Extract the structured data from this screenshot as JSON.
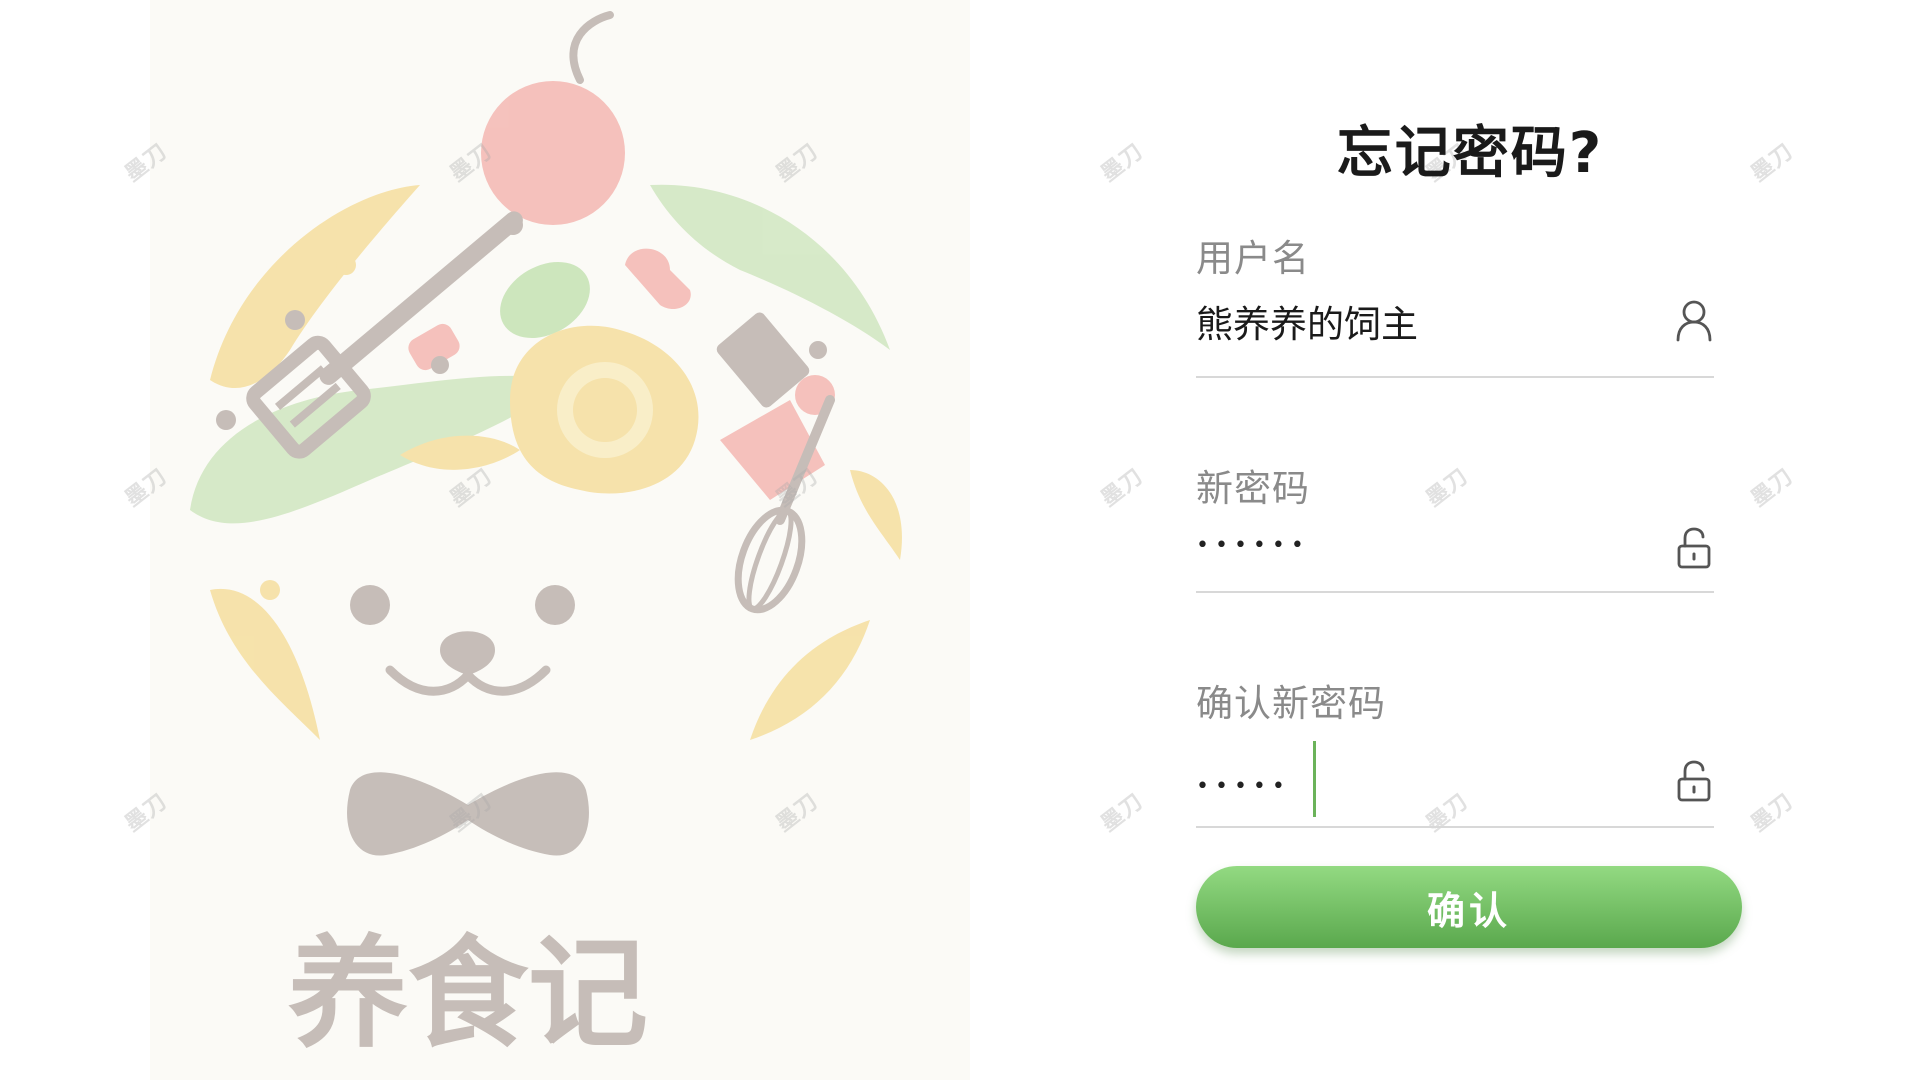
{
  "logo": {
    "brand_text": "养食记"
  },
  "watermark_text": "墨刀",
  "form": {
    "title": "忘记密码?",
    "username": {
      "label": "用户名",
      "value": "熊养养的饲主",
      "icon": "user-icon"
    },
    "new_password": {
      "label": "新密码",
      "value": "••••••",
      "icon": "unlock-icon"
    },
    "confirm_password": {
      "label": "确认新密码",
      "value": "•••••",
      "icon": "unlock-icon"
    },
    "submit_label": "确认"
  },
  "colors": {
    "accent_green": "#5aa84d",
    "accent_green_light": "#93da82",
    "title_text": "#1a1a1a",
    "label_text": "#8a8a8a"
  }
}
